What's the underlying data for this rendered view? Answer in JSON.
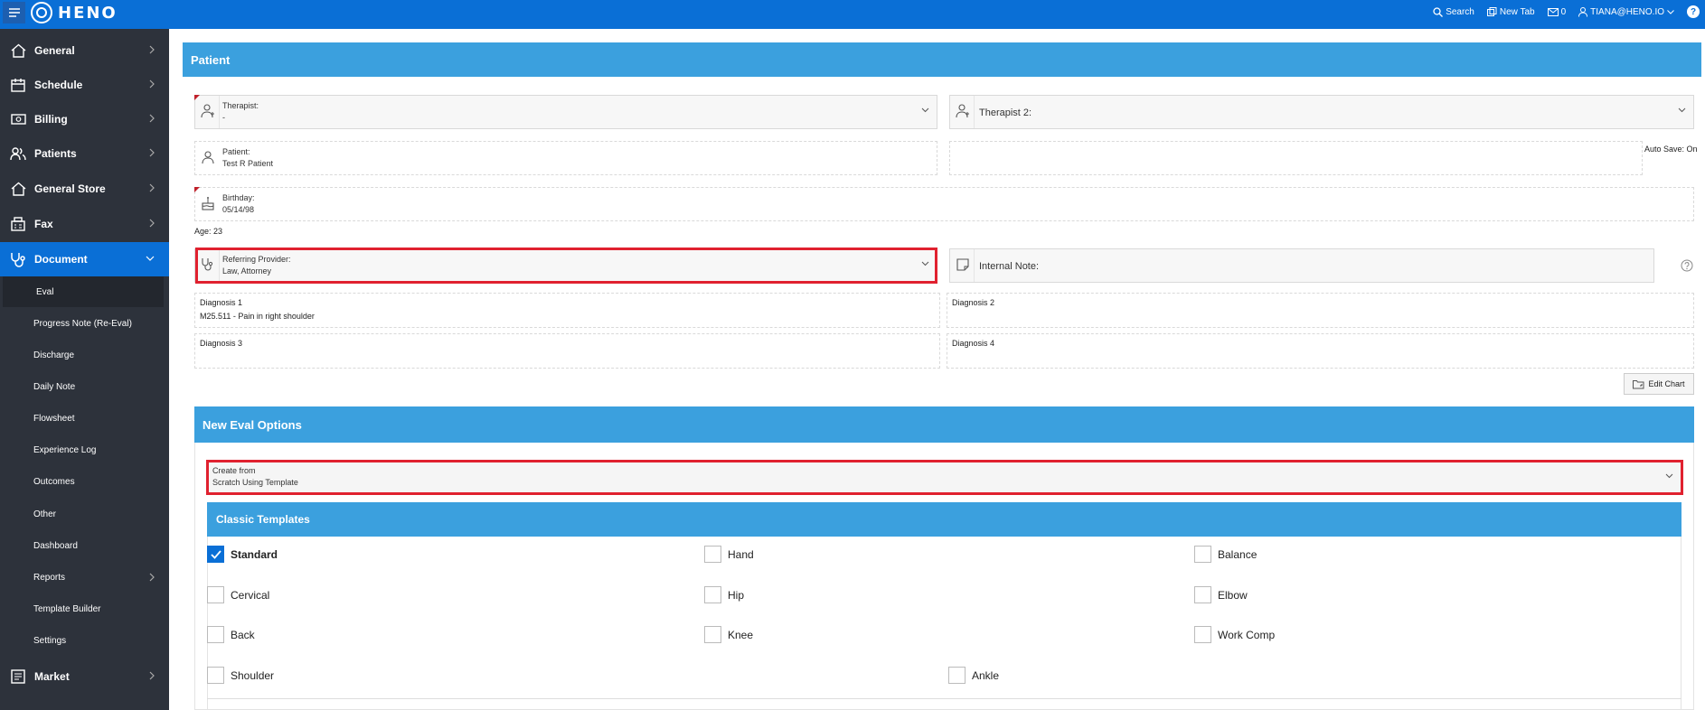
{
  "app": {
    "brand": "HENO"
  },
  "topbar": {
    "search_label": "Search",
    "new_tab_label": "New Tab",
    "messages_count": "0",
    "user_label": "TIANA@HENO.IO",
    "help_label": "?"
  },
  "sidebar": {
    "items": [
      {
        "label": "General"
      },
      {
        "label": "Schedule"
      },
      {
        "label": "Billing"
      },
      {
        "label": "Patients"
      },
      {
        "label": "General Store"
      },
      {
        "label": "Fax"
      },
      {
        "label": "Document"
      },
      {
        "label": "Market"
      }
    ],
    "sub_items": [
      {
        "label": "Eval"
      },
      {
        "label": "Progress Note (Re-Eval)"
      },
      {
        "label": "Discharge"
      },
      {
        "label": "Daily Note"
      },
      {
        "label": "Flowsheet"
      },
      {
        "label": "Experience Log"
      },
      {
        "label": "Outcomes"
      },
      {
        "label": "Other"
      },
      {
        "label": "Dashboard"
      },
      {
        "label": "Reports"
      },
      {
        "label": "Template Builder"
      },
      {
        "label": "Settings"
      }
    ]
  },
  "patient_panel": {
    "title": "Patient",
    "therapist": {
      "label": "Therapist:",
      "value": "-"
    },
    "therapist2": {
      "label": "Therapist 2:"
    },
    "patient": {
      "label": "Patient:",
      "value": "Test R Patient"
    },
    "auto_save": "Auto Save: On",
    "birthday": {
      "label": "Birthday:",
      "value": "05/14/98"
    },
    "age": "Age: 23",
    "referring_provider": {
      "label": "Referring Provider:",
      "value": "Law, Attorney"
    },
    "internal_note": {
      "label": "Internal Note:"
    },
    "diagnosis1": {
      "label": "Diagnosis 1",
      "value": "M25.511 - Pain in right shoulder"
    },
    "diagnosis2": {
      "label": "Diagnosis 2"
    },
    "diagnosis3": {
      "label": "Diagnosis 3"
    },
    "diagnosis4": {
      "label": "Diagnosis 4"
    },
    "edit_chart_label": "Edit Chart"
  },
  "new_eval": {
    "title": "New Eval Options",
    "create_from": {
      "label": "Create from",
      "value": "Scratch Using Template"
    },
    "classic_templates_title": "Classic Templates",
    "templates": [
      {
        "label": "Standard",
        "checked": true
      },
      {
        "label": "Hand",
        "checked": false
      },
      {
        "label": "Balance",
        "checked": false
      },
      {
        "label": "Cervical",
        "checked": false
      },
      {
        "label": "Hip",
        "checked": false
      },
      {
        "label": "Elbow",
        "checked": false
      },
      {
        "label": "Back",
        "checked": false
      },
      {
        "label": "Knee",
        "checked": false
      },
      {
        "label": "Work Comp",
        "checked": false
      },
      {
        "label": "Shoulder",
        "checked": false
      },
      {
        "label": "Ankle",
        "checked": false
      }
    ]
  },
  "colors": {
    "topbar": "#0a6fd6",
    "sidebar": "#2d323b",
    "panel_header": "#3ba0de",
    "highlight": "#e0212f"
  }
}
